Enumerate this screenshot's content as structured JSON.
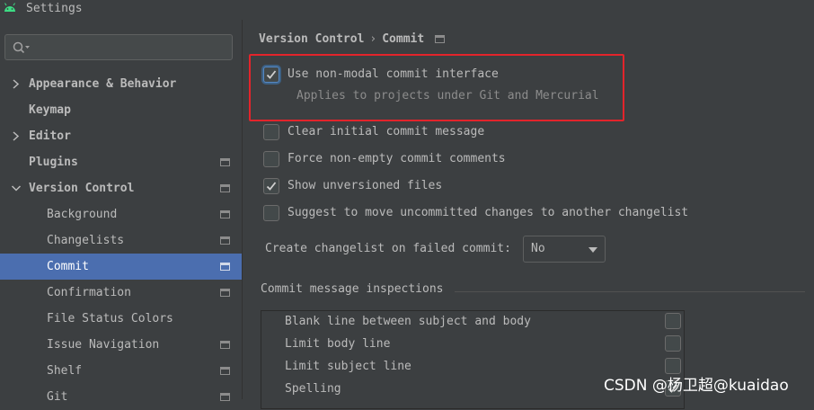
{
  "window": {
    "title": "Settings",
    "app_icon": "android-icon"
  },
  "search": {
    "placeholder": "",
    "icon": "search-icon"
  },
  "sidebar": {
    "items": [
      {
        "label": "Appearance & Behavior",
        "expandable": true,
        "expanded": false
      },
      {
        "label": "Keymap"
      },
      {
        "label": "Editor",
        "expandable": true,
        "expanded": false
      },
      {
        "label": "Plugins",
        "project_icon": true
      },
      {
        "label": "Version Control",
        "expandable": true,
        "expanded": true,
        "project_icon": true
      },
      {
        "label": "Background",
        "project_icon": true
      },
      {
        "label": "Changelists",
        "project_icon": true
      },
      {
        "label": "Commit",
        "project_icon": true,
        "selected": true
      },
      {
        "label": "Confirmation",
        "project_icon": true
      },
      {
        "label": "File Status Colors"
      },
      {
        "label": "Issue Navigation",
        "project_icon": true
      },
      {
        "label": "Shelf",
        "project_icon": true
      },
      {
        "label": "Git",
        "project_icon": true
      }
    ]
  },
  "breadcrumb": {
    "parent": "Version Control",
    "separator": "›",
    "current": "Commit"
  },
  "options": {
    "non_modal": {
      "label": "Use non-modal commit interface",
      "checked": true,
      "hint": "Applies to projects under Git and Mercurial"
    },
    "clear_initial": {
      "label": "Clear initial commit message",
      "checked": false
    },
    "force_non_empty": {
      "label": "Force non-empty commit comments",
      "checked": false
    },
    "show_unversioned": {
      "label": "Show unversioned files",
      "checked": true
    },
    "suggest_move": {
      "label": "Suggest to move uncommitted changes to another changelist",
      "checked": false
    }
  },
  "failed_commit": {
    "label": "Create changelist on failed commit:",
    "value": "No"
  },
  "inspections": {
    "title": "Commit message inspections",
    "rows": [
      {
        "label": "Blank line between subject and body",
        "checked": false
      },
      {
        "label": "Limit body line",
        "checked": false
      },
      {
        "label": "Limit subject line",
        "checked": false
      },
      {
        "label": "Spelling",
        "checked": true
      }
    ]
  },
  "watermark": "CSDN @杨卫超@kuaidao",
  "colors": {
    "selection": "#4b6eaf",
    "background": "#3c3f41",
    "highlight_border": "#e3242b",
    "text": "#bbbbbb"
  }
}
